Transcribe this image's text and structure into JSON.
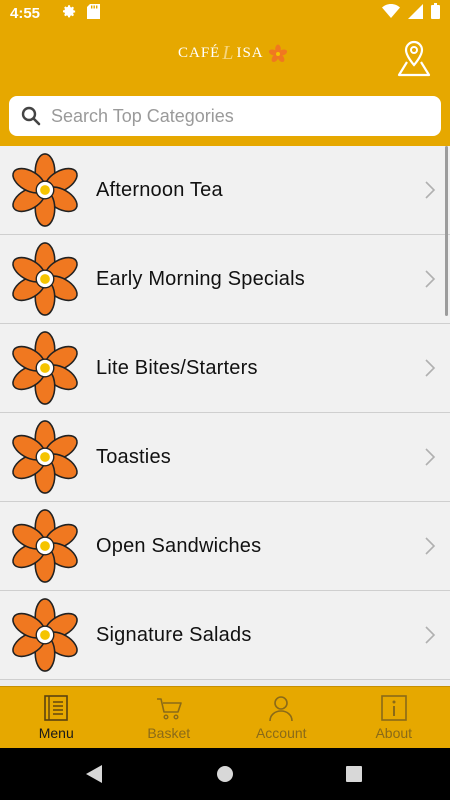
{
  "status_bar": {
    "time": "4:55",
    "icons": [
      "gear-icon",
      "sd-card-icon",
      "wifi-icon",
      "signal-icon",
      "battery-icon"
    ]
  },
  "app_bar": {
    "logo_text_left": "CAFÉ",
    "logo_text_mid": "L",
    "logo_text_right": "ISA",
    "location_icon": "location-pin-icon"
  },
  "search": {
    "placeholder": "Search Top Categories",
    "value": ""
  },
  "categories": [
    {
      "label": "Afternoon Tea"
    },
    {
      "label": "Early Morning Specials"
    },
    {
      "label": "Lite Bites/Starters"
    },
    {
      "label": "Toasties"
    },
    {
      "label": "Open Sandwiches"
    },
    {
      "label": "Signature Salads"
    }
  ],
  "bottom_nav": {
    "items": [
      {
        "label": "Menu",
        "icon": "menu-book-icon",
        "active": true
      },
      {
        "label": "Basket",
        "icon": "cart-icon",
        "active": false
      },
      {
        "label": "Account",
        "icon": "person-icon",
        "active": false
      },
      {
        "label": "About",
        "icon": "info-icon",
        "active": false
      }
    ]
  },
  "colors": {
    "brand": "#e6a800",
    "flower_orange": "#f07820",
    "flower_center": "#f5c400"
  }
}
